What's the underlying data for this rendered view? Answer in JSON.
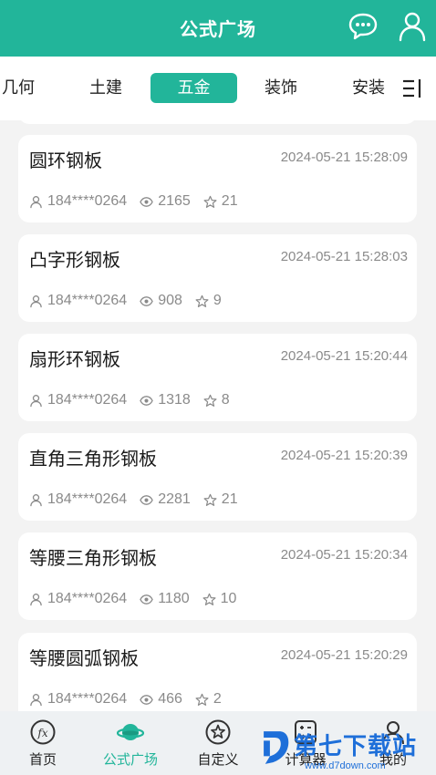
{
  "header": {
    "title": "公式广场",
    "icons": [
      "message-icon",
      "user-icon"
    ]
  },
  "tabs": {
    "items": [
      "几何",
      "土建",
      "五金",
      "装饰",
      "安装"
    ],
    "active": "五金",
    "menu_icon": "menu-icon"
  },
  "formulas": [
    {
      "name": "圆环钢板",
      "date": "2024-05-21 15:28:09",
      "user": "184****0264",
      "views": "2165",
      "stars": "21"
    },
    {
      "name": "凸字形钢板",
      "date": "2024-05-21 15:28:03",
      "user": "184****0264",
      "views": "908",
      "stars": "9"
    },
    {
      "name": "扇形环钢板",
      "date": "2024-05-21 15:20:44",
      "user": "184****0264",
      "views": "1318",
      "stars": "8"
    },
    {
      "name": "直角三角形钢板",
      "date": "2024-05-21 15:20:39",
      "user": "184****0264",
      "views": "2281",
      "stars": "21"
    },
    {
      "name": "等腰三角形钢板",
      "date": "2024-05-21 15:20:34",
      "user": "184****0264",
      "views": "1180",
      "stars": "10"
    },
    {
      "name": "等腰圆弧钢板",
      "date": "2024-05-21 15:20:29",
      "user": "184****0264",
      "views": "466",
      "stars": "2"
    }
  ],
  "bottom_nav": {
    "items": [
      {
        "label": "首页",
        "icon": "fx-icon"
      },
      {
        "label": "公式广场",
        "icon": "planet-icon"
      },
      {
        "label": "自定义",
        "icon": "star-circle-icon"
      },
      {
        "label": "计算器",
        "icon": "calculator-icon"
      },
      {
        "label": "我的",
        "icon": "person-icon"
      }
    ],
    "active": "公式广场"
  },
  "watermark": {
    "text": "第七下载站",
    "url": "www.d7down.com"
  },
  "colors": {
    "accent": "#22b59a",
    "background": "#f3f3f3",
    "card": "#ffffff",
    "muted_text": "#8a8a8a"
  }
}
